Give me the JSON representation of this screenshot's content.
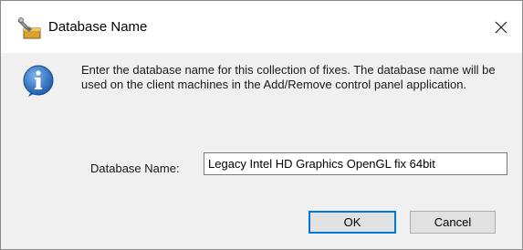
{
  "dialog": {
    "title": "Database Name",
    "app_icon": "compatibility-fix-icon",
    "close_icon": "close-icon",
    "info_icon": "info-icon",
    "message": "Enter the database name for this collection of fixes. The database name will be used on the client machines in the Add/Remove control panel application.",
    "field_label": "Database Name:",
    "field_value": "Legacy Intel HD Graphics OpenGL fix 64bit",
    "ok_label": "OK",
    "cancel_label": "Cancel",
    "colors": {
      "focus_border": "#0078d7",
      "info_blue": "#2f6fb8"
    }
  }
}
